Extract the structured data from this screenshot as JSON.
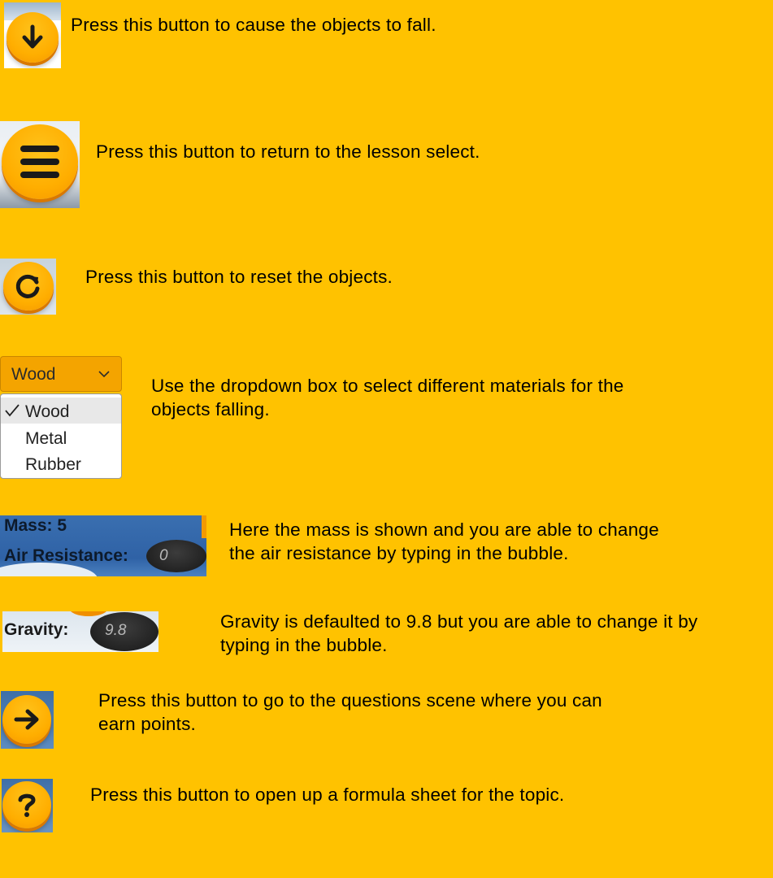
{
  "colors": {
    "background": "#FFC200",
    "button_orange": "#FFAE00",
    "panel_blue": "#2F62A6",
    "bubble_dark": "#222222"
  },
  "rows": [
    {
      "icon": "arrow-down-icon",
      "text": "Press this button to cause the objects to fall."
    },
    {
      "icon": "menu-icon",
      "text": "Press this button to return to the lesson select."
    },
    {
      "icon": "reset-icon",
      "text": "Press this button to reset the objects."
    },
    {
      "icon": "dropdown",
      "line1": "Use the dropdown box to select different materials for the",
      "line2": "objects falling."
    },
    {
      "icon": "mass-panel",
      "line1": "Here the mass is shown and you are able to change",
      "line2": "the air resistance by typing in the bubble."
    },
    {
      "icon": "gravity-panel",
      "line1": "Gravity is defaulted to 9.8 but you are able to change it by",
      "line2": "typing in the bubble."
    },
    {
      "icon": "arrow-right-icon",
      "line1": "Press this button to go to the questions scene where you can",
      "line2": "earn points."
    },
    {
      "icon": "question-icon",
      "text": "Press this button to open up a formula sheet for the topic."
    }
  ],
  "dropdown": {
    "selected": "Wood",
    "options": [
      "Wood",
      "Metal",
      "Rubber"
    ],
    "checkmark": "✓"
  },
  "mass_panel": {
    "mass_label": "Mass: 5",
    "air_label": "Air Resistance:",
    "air_value": "0"
  },
  "gravity_panel": {
    "label": "Gravity:",
    "value": "9.8"
  }
}
